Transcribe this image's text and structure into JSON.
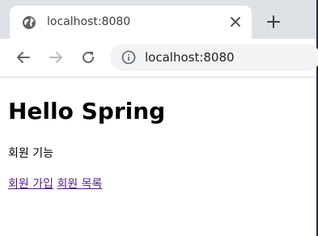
{
  "browser": {
    "tab": {
      "title": "localhost:8080",
      "favicon": "globe-icon",
      "close_icon": "close-icon"
    },
    "new_tab_icon": "plus-icon",
    "toolbar": {
      "back_icon": "back-arrow-icon",
      "forward_icon": "forward-arrow-icon",
      "reload_icon": "reload-icon",
      "site_info_icon": "info-icon",
      "url": "localhost:8080"
    }
  },
  "page": {
    "heading": "Hello Spring",
    "feature_label": "회원 기능",
    "links": [
      {
        "label": "회원 가입"
      },
      {
        "label": "회원 목록"
      }
    ],
    "link_color": "#551a8b"
  }
}
